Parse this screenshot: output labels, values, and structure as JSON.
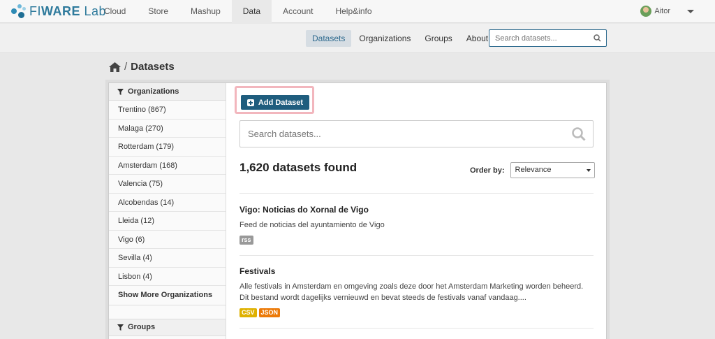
{
  "brand": {
    "name_light": "FI",
    "name_bold": "WARE",
    "name_suffix": " Lab"
  },
  "topnav": [
    "Cloud",
    "Store",
    "Mashup",
    "Data",
    "Account",
    "Help&info"
  ],
  "user": {
    "name": "Aitor"
  },
  "subnav": {
    "links": [
      "Datasets",
      "Organizations",
      "Groups",
      "About"
    ],
    "search_placeholder": "Search datasets..."
  },
  "breadcrumb": {
    "separator": "/",
    "current": "Datasets"
  },
  "sidebar": {
    "organizations_heading": "Organizations",
    "organizations": [
      "Trentino (867)",
      "Malaga (270)",
      "Rotterdam (179)",
      "Amsterdam (168)",
      "Valencia (75)",
      "Alcobendas (14)",
      "Lleida (12)",
      "Vigo (6)",
      "Sevilla (4)",
      "Lisbon (4)"
    ],
    "show_more": "Show More Organizations",
    "groups_heading": "Groups"
  },
  "main": {
    "add_dataset": "Add Dataset",
    "search_placeholder": "Search datasets...",
    "found": "1,620 datasets found",
    "order_by_label": "Order by:",
    "order_by_value": "Relevance",
    "datasets": [
      {
        "title": "Vigo: Noticias do Xornal de Vigo",
        "description": "Feed de noticias del ayuntamiento de Vigo",
        "tags": [
          {
            "label": "rss",
            "color": "#999999"
          }
        ]
      },
      {
        "title": "Festivals",
        "description": "Alle festivals in Amsterdam en omgeving zoals deze door het Amsterdam Marketing worden beheerd. Dit bestand wordt dagelijks vernieuwd en bevat steeds de festivals vanaf vandaag....",
        "tags": [
          {
            "label": "CSV",
            "color": "#dfb100"
          },
          {
            "label": "JSON",
            "color": "#ec7a08"
          }
        ]
      }
    ]
  }
}
